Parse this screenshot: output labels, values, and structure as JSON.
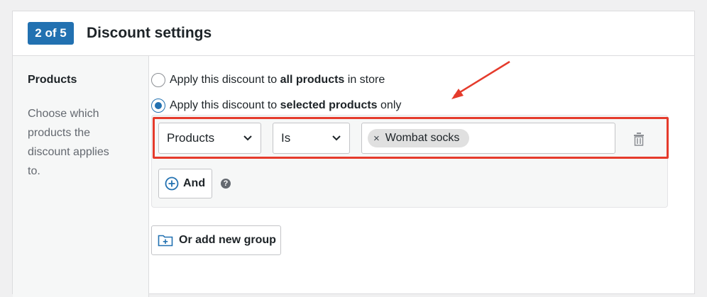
{
  "header": {
    "step_badge": "2 of 5",
    "title": "Discount settings"
  },
  "sidebar": {
    "title": "Products",
    "description": "Choose which products the discount applies to."
  },
  "options": [
    {
      "prefix": "Apply this discount to ",
      "bold": "all products",
      "suffix": " in store",
      "checked": false
    },
    {
      "prefix": "Apply this discount to ",
      "bold": "selected products",
      "suffix": " only",
      "checked": true
    }
  ],
  "rule": {
    "field_select": "Products",
    "operator_select": "Is",
    "tags": [
      "Wombat socks"
    ],
    "tag_remove": "×"
  },
  "buttons": {
    "and_label": "And",
    "help": "?",
    "add_group_label": "Or add new group"
  },
  "colors": {
    "accent": "#2271b1",
    "highlight": "#e53b2c"
  }
}
